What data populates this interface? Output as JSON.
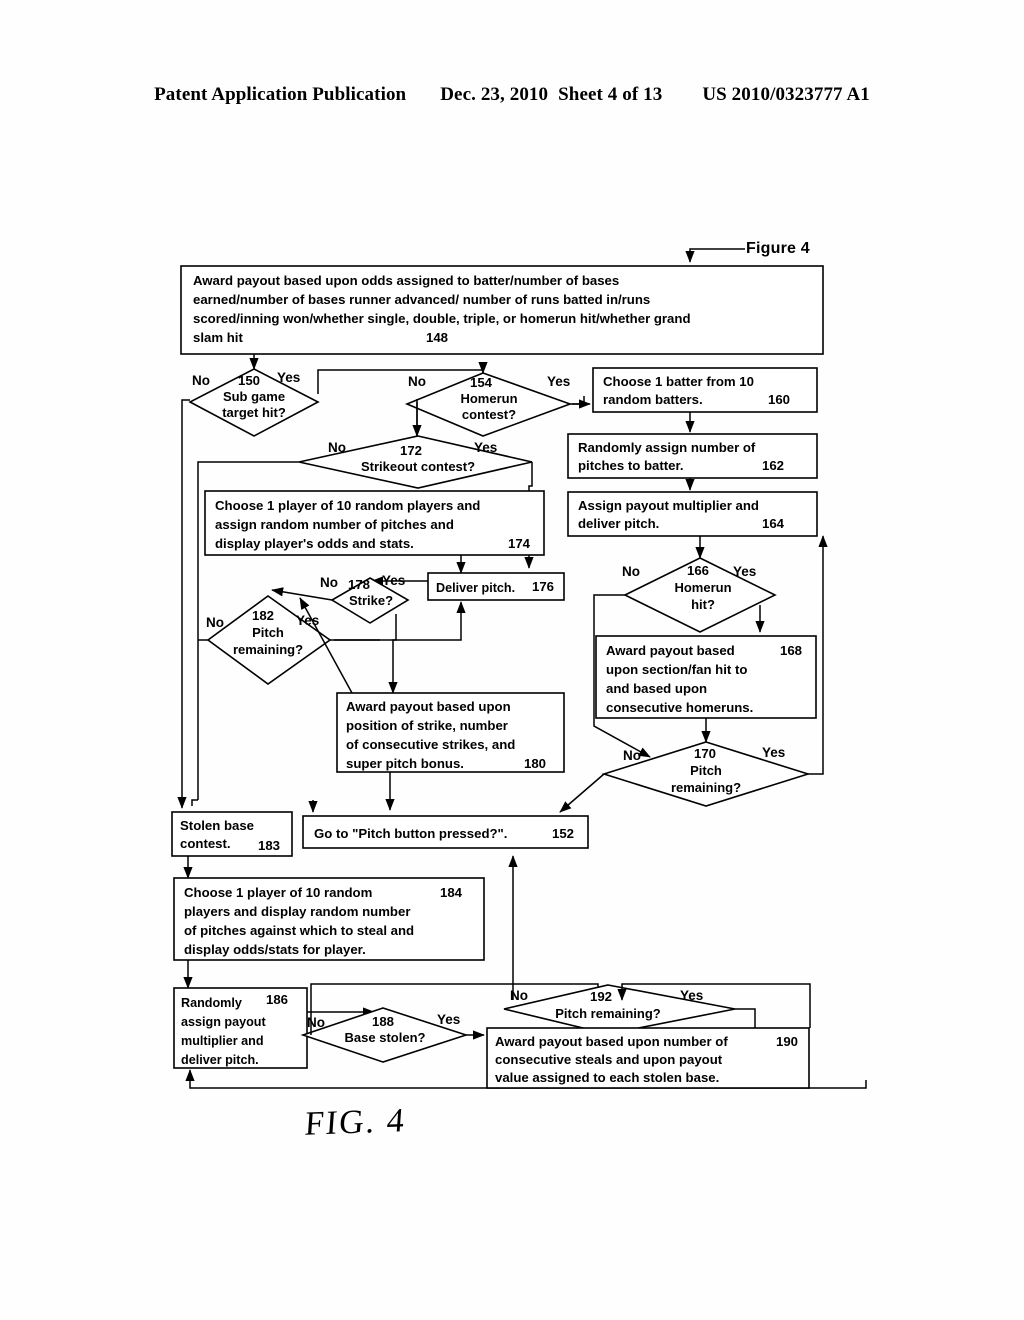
{
  "header": {
    "publication": "Patent Application Publication",
    "date": "Dec. 23, 2010",
    "sheet": "Sheet 4 of 13",
    "patent_number": "US 2010/0323777 A1"
  },
  "figure": {
    "caption": "Figure 4",
    "handwritten_label": "FIG. 4"
  },
  "labels": {
    "yes": "Yes",
    "no": "No"
  },
  "nodes": {
    "n148": {
      "ref": "148",
      "line1": "Award payout based upon odds assigned to batter/number of bases",
      "line2": "earned/number of bases runner advanced/ number of runs batted in/runs",
      "line3": "scored/inning won/whether single, double, triple, or homerun hit/whether grand",
      "line4": "slam hit"
    },
    "n150": {
      "ref": "150",
      "line1": "Sub game",
      "line2": "target hit?"
    },
    "n154": {
      "ref": "154",
      "line1": "Homerun",
      "line2": "contest?"
    },
    "n160": {
      "ref": "160",
      "line1": "Choose 1 batter from 10",
      "line2": "random batters."
    },
    "n162": {
      "ref": "162",
      "line1": "Randomly assign number of",
      "line2": "pitches to batter."
    },
    "n164": {
      "ref": "164",
      "line1": "Assign payout multiplier and",
      "line2": "deliver pitch."
    },
    "n166": {
      "ref": "166",
      "line1": "Homerun",
      "line2": "hit?"
    },
    "n168": {
      "ref": "168",
      "line1": "Award payout based",
      "line2": "upon section/fan hit to",
      "line3": "and based upon",
      "line4": "consecutive homeruns."
    },
    "n170": {
      "ref": "170",
      "line1": "Pitch",
      "line2": "remaining?"
    },
    "n172": {
      "ref": "172",
      "line1": "Strikeout contest?"
    },
    "n174": {
      "ref": "174",
      "line1": "Choose 1 player of 10 random players and",
      "line2": "assign random number of pitches and",
      "line3": "display player's odds and stats."
    },
    "n176": {
      "ref": "176",
      "line1": "Deliver pitch."
    },
    "n178": {
      "ref": "178",
      "line1": "Strike?"
    },
    "n180": {
      "ref": "180",
      "line1": "Award payout based upon",
      "line2": "position of strike, number",
      "line3": "of consecutive strikes, and",
      "line4": "super pitch bonus."
    },
    "n182": {
      "ref": "182",
      "line1": "Pitch",
      "line2": "remaining?"
    },
    "n183": {
      "ref": "183",
      "line1": "Stolen base",
      "line2": "contest."
    },
    "n152": {
      "ref": "152",
      "line1": "Go to \"Pitch button pressed?\"."
    },
    "n184": {
      "ref": "184",
      "line1": "Choose 1 player of 10 random",
      "line2": "players and display random number",
      "line3": "of pitches against which to steal and",
      "line4": "display odds/stats for player."
    },
    "n186": {
      "ref": "186",
      "line1": "Randomly",
      "line2": "assign payout",
      "line3": "multiplier and",
      "line4": "deliver pitch."
    },
    "n188": {
      "ref": "188",
      "line1": "Base stolen?"
    },
    "n190": {
      "ref": "190",
      "line1": "Award payout based upon number of",
      "line2": "consecutive steals and upon payout",
      "line3": "value assigned to each stolen base."
    },
    "n192": {
      "ref": "192",
      "line1": "Pitch remaining?"
    }
  }
}
